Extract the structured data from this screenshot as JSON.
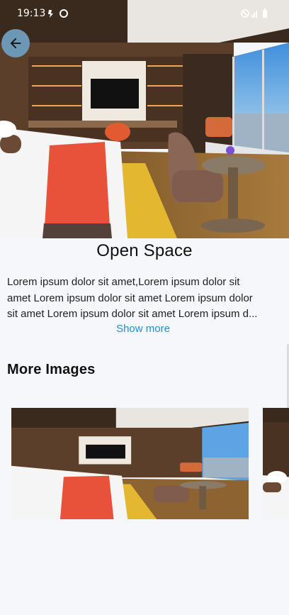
{
  "status_bar": {
    "time": "19:13"
  },
  "hero": {
    "image_name": "hotel-room-photo"
  },
  "detail": {
    "title": "Open Space",
    "description_lines": [
      "Lorem ipsum dolor sit amet,Lorem ipsum dolor sit",
      "amet Lorem ipsum dolor sit amet Lorem ipsum dolor",
      "sit amet Lorem ipsum dolor sit amet Lorem ipsum d..."
    ],
    "show_more": "Show more"
  },
  "more_images": {
    "title": "More Images",
    "items": [
      {
        "name": "gallery-image-1"
      },
      {
        "name": "gallery-image-2"
      }
    ]
  },
  "colors": {
    "background": "#f6f7fb",
    "accent": "#1f8fd1",
    "back_button": "#6c97b5"
  }
}
